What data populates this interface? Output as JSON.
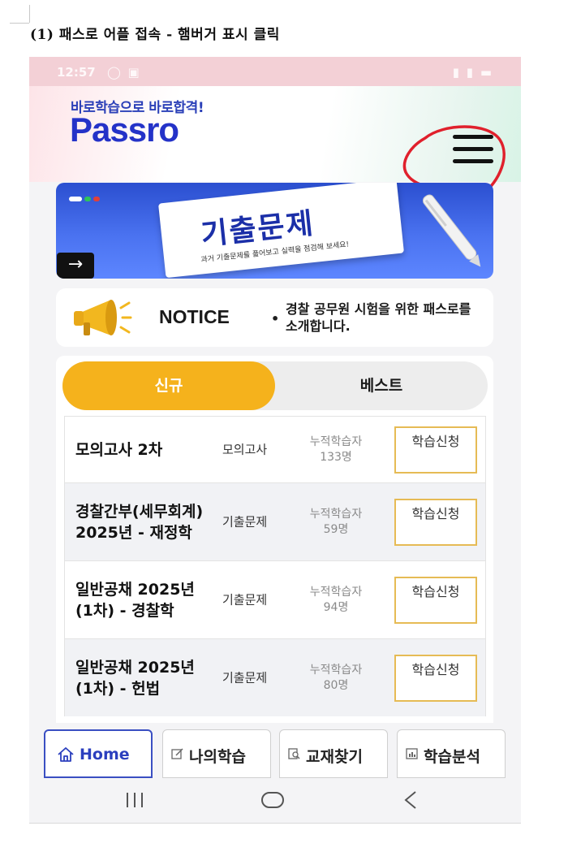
{
  "doc": {
    "title": "(1) 패스로 어플 접속 - 햄버거 표시 클릭"
  },
  "status_bar": {
    "time": "12:57",
    "left_icons": "◯ ▣",
    "right_icons": "▮ ▮ ▬"
  },
  "header": {
    "slogan": "바로학습으로 바로합격!",
    "logo": "Passro",
    "menu_icon": "hamburger-menu-icon",
    "highlight_color": "#e0202c"
  },
  "banner": {
    "title": "기출문제",
    "subtitle": "과거 기출문제를 풀어보고 실력을 점검해 보세요!",
    "arrow": "→",
    "dot_colors": [
      "#ffffff",
      "#2ec45a",
      "#e0403a"
    ]
  },
  "notice": {
    "label": "NOTICE",
    "bullet": "•",
    "text": "경찰 공무원 시험을 위한 패스로를 소개합니다."
  },
  "tabs": {
    "active": "신규",
    "inactive": "베스트"
  },
  "courses": [
    {
      "name": "모의고사 2차",
      "type": "모의고사",
      "stat": "누적학습자 133명",
      "button": "학습신청"
    },
    {
      "name": "경찰간부(세무회계) 2025년 - 재정학",
      "type": "기출문제",
      "stat": "누적학습자 59명",
      "button": "학습신청"
    },
    {
      "name": "일반공채 2025년(1차) - 경찰학",
      "type": "기출문제",
      "stat": "누적학습자 94명",
      "button": "학습신청"
    },
    {
      "name": "일반공채 2025년(1차) - 헌법",
      "type": "기출문제",
      "stat": "누적학습자 80명",
      "button": "학습신청"
    }
  ],
  "bottom_nav": {
    "home": "Home",
    "my_study": "나의학습",
    "find_books": "교재찾기",
    "analysis": "학습분석"
  },
  "system_nav": {
    "recents": "|||",
    "home": "◯",
    "back": "<"
  },
  "colors": {
    "brand_blue": "#2432c8",
    "tab_active": "#f5b21c",
    "button_border": "#e6bb55"
  }
}
